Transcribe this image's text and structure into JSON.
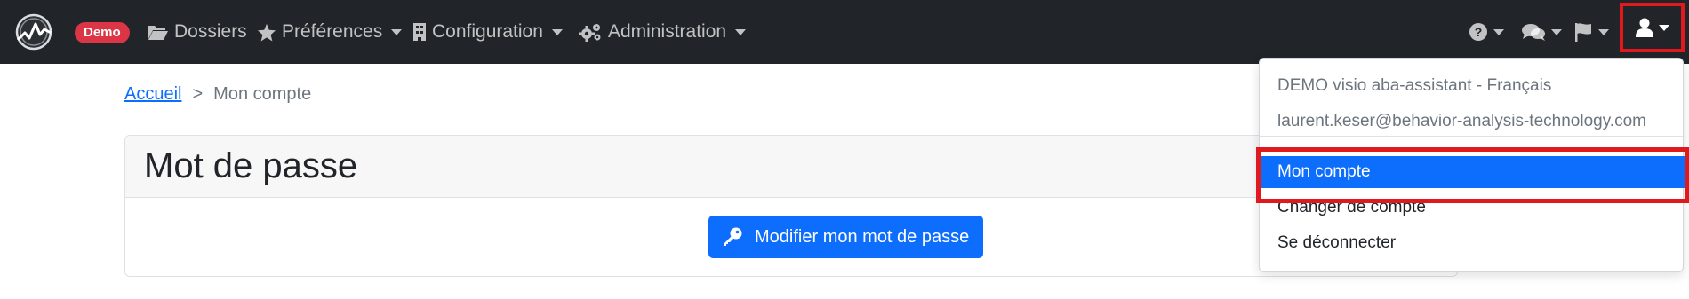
{
  "navbar": {
    "badge": "Demo",
    "menu": [
      {
        "label": "Dossiers",
        "icon": "folder-open-icon",
        "has_caret": false
      },
      {
        "label": "Préférences",
        "icon": "star-icon",
        "has_caret": true
      },
      {
        "label": "Configuration",
        "icon": "building-icon",
        "has_caret": true
      },
      {
        "label": "Administration",
        "icon": "cogs-icon",
        "has_caret": true
      }
    ],
    "right_icons": [
      "help-icon",
      "comments-icon",
      "flag-icon",
      "user-icon"
    ]
  },
  "breadcrumb": {
    "home": "Accueil",
    "separator": ">",
    "current": "Mon compte"
  },
  "card": {
    "title": "Mot de passe",
    "button_label": "Modifier mon mot de passe",
    "button_icon": "key-icon"
  },
  "user_dropdown": {
    "account_name": "DEMO visio aba-assistant - Français",
    "email": "laurent.keser@behavior-analysis-technology.com",
    "items": [
      {
        "label": "Mon compte",
        "active": true
      },
      {
        "label": "Changer de compte",
        "active": false
      },
      {
        "label": "Se déconnecter",
        "active": false
      }
    ]
  },
  "colors": {
    "navbar_bg": "#212529",
    "primary": "#0d6efd",
    "badge_bg": "#dc3545",
    "highlight": "#e0191f"
  }
}
